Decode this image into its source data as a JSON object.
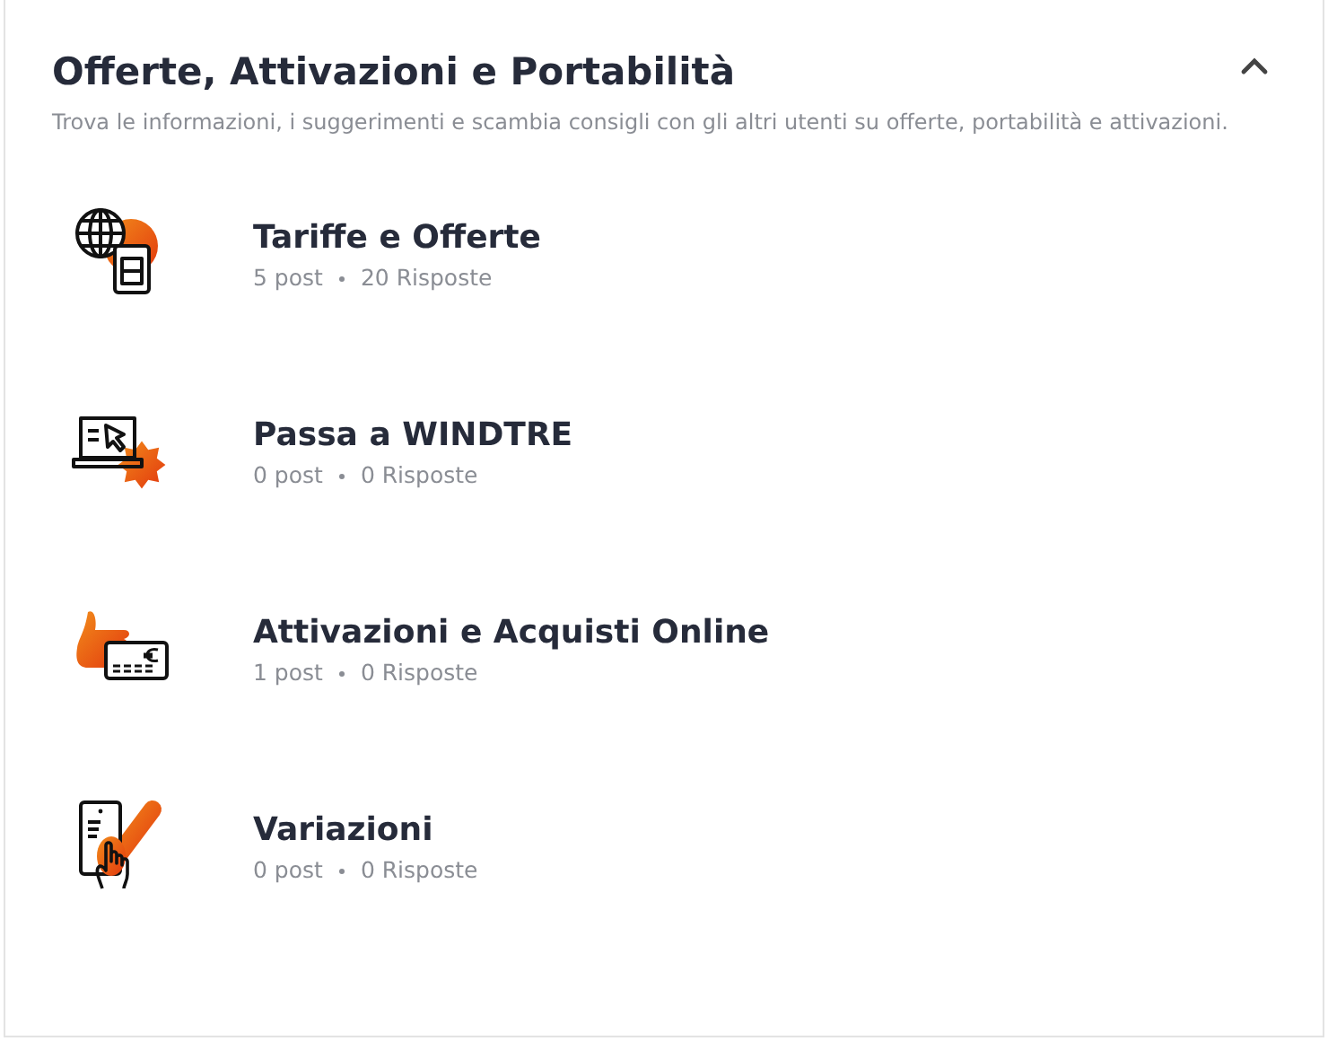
{
  "section": {
    "title": "Offerte, Attivazioni e Portabilità",
    "expanded": true,
    "description": "Trova le informazioni, i suggerimenti e scambia consigli con gli altri utenti su offerte, portabilità e attivazioni."
  },
  "boards": [
    {
      "kind": "globe-sim",
      "title": "Tariffe e Offerte",
      "posts": "5 post",
      "replies": "20 Risposte"
    },
    {
      "kind": "laptop",
      "title": "Passa a WINDTRE",
      "posts": "0 post",
      "replies": "0 Risposte"
    },
    {
      "kind": "card",
      "title": "Attivazioni e Acquisti Online",
      "posts": "1 post",
      "replies": "0 Risposte"
    },
    {
      "kind": "phone-check",
      "title": "Variazioni",
      "posts": "0 post",
      "replies": "0 Risposte"
    }
  ]
}
